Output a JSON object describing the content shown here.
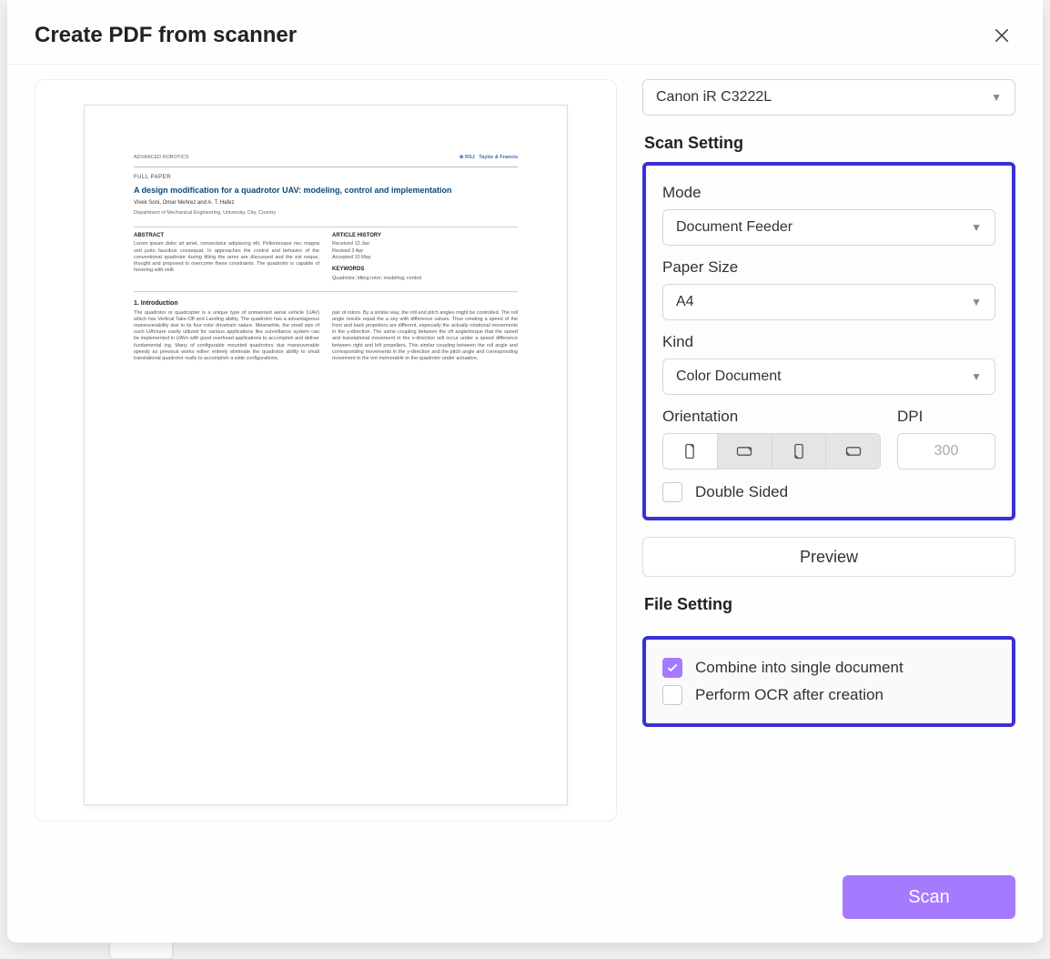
{
  "dialog": {
    "title": "Create PDF from scanner",
    "scanner_selected": "Canon iR C3222L",
    "scan_setting_heading": "Scan Setting",
    "file_setting_heading": "File Setting",
    "preview_button": "Preview",
    "scan_button": "Scan"
  },
  "scan_settings": {
    "mode_label": "Mode",
    "mode_value": "Document Feeder",
    "paper_size_label": "Paper Size",
    "paper_size_value": "A4",
    "kind_label": "Kind",
    "kind_value": "Color Document",
    "orientation_label": "Orientation",
    "orientation_selected_index": 0,
    "dpi_label": "DPI",
    "dpi_value": "300",
    "double_sided_label": "Double Sided",
    "double_sided_checked": false
  },
  "file_settings": {
    "combine_label": "Combine into single document",
    "combine_checked": true,
    "ocr_label": "Perform OCR after creation",
    "ocr_checked": false
  },
  "preview_document": {
    "section": "FULL PAPER",
    "title": "A design modification for a quadrotor UAV: modeling, control and implementation",
    "intro_heading": "1. Introduction"
  }
}
